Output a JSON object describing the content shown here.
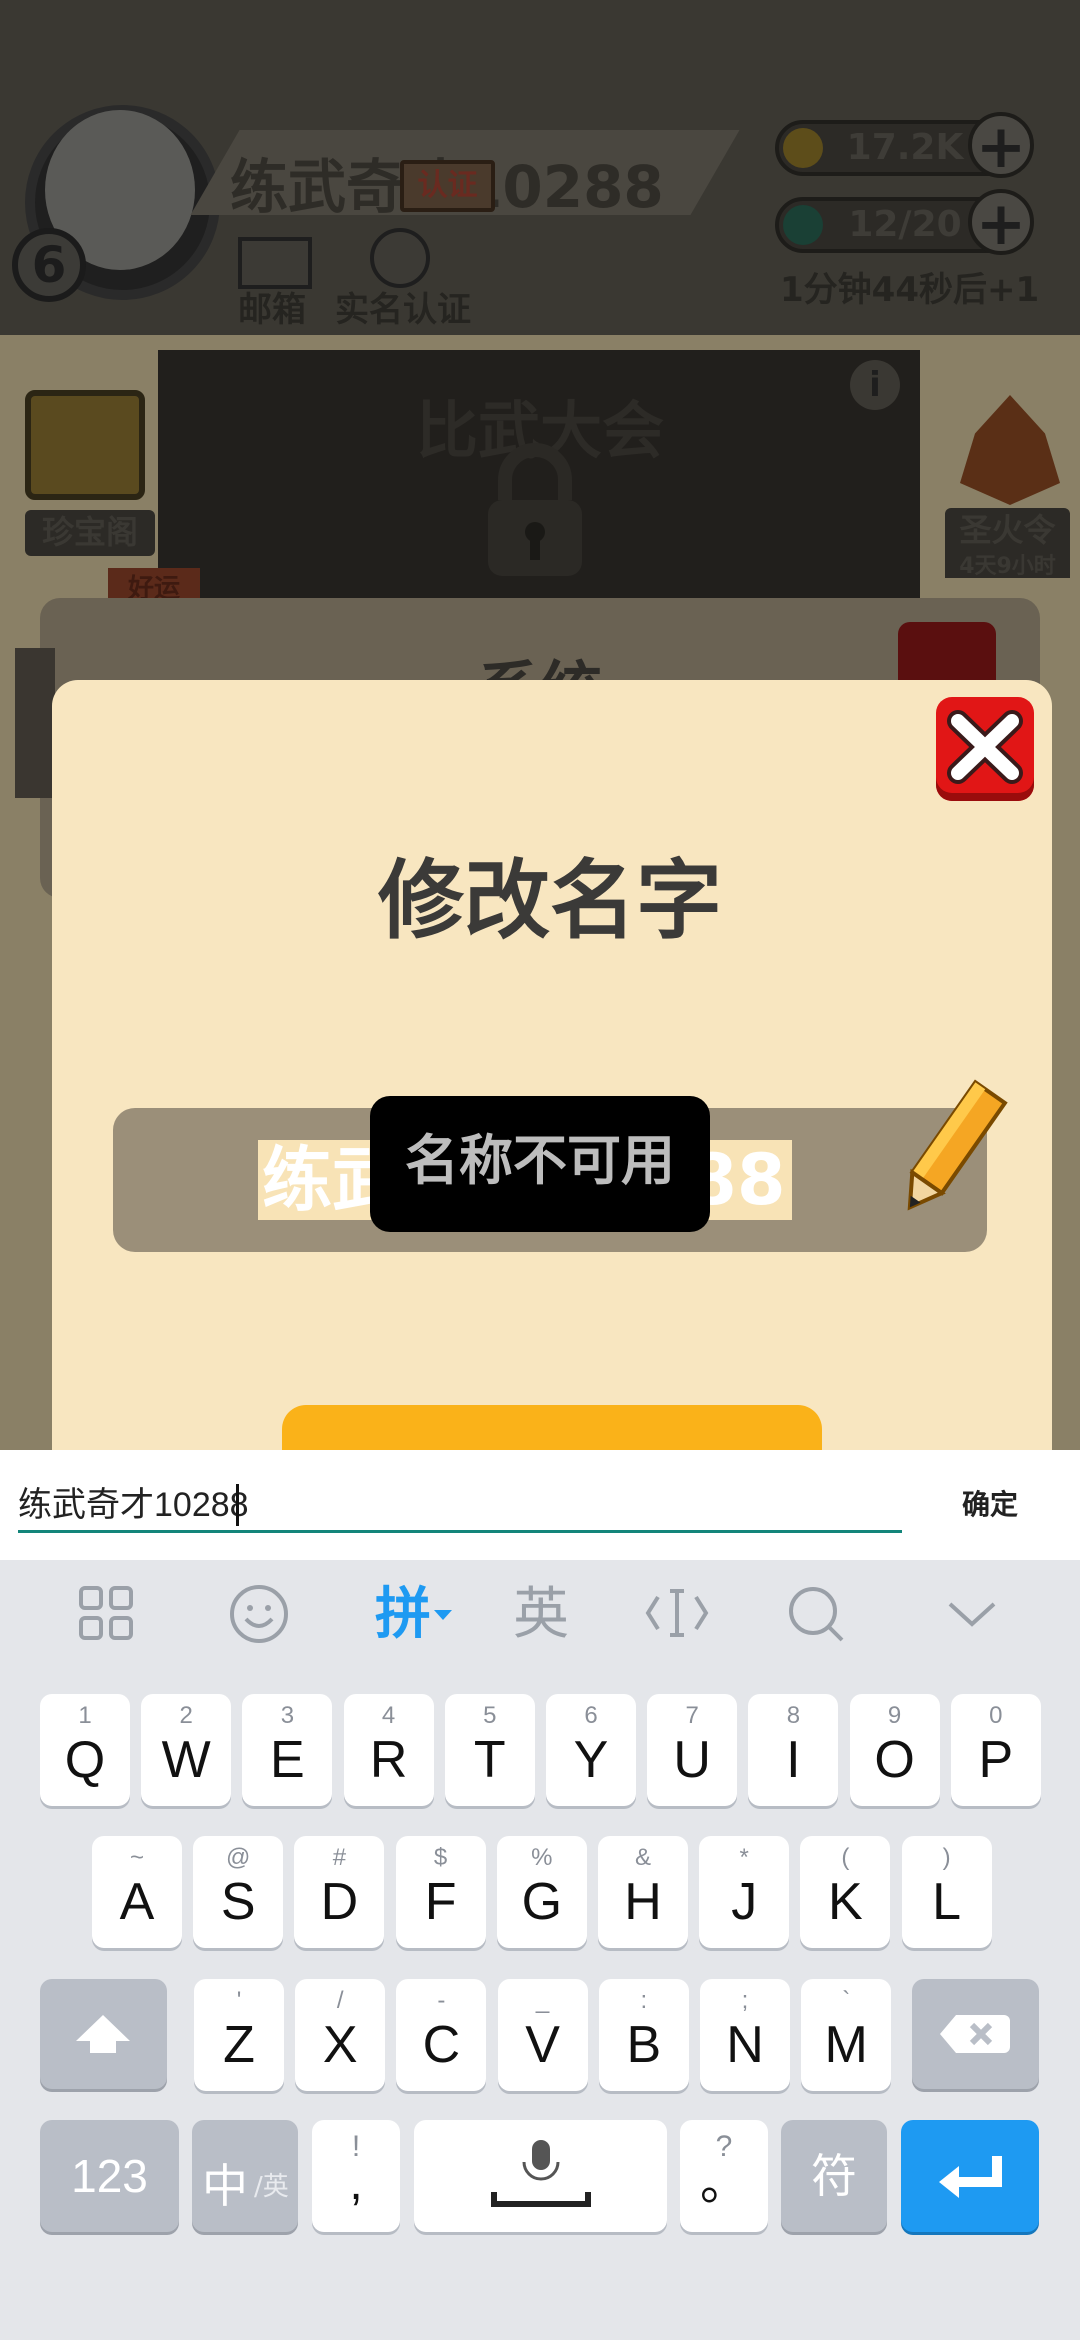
{
  "game": {
    "level": "6",
    "player_name": "练武奇才10288",
    "verify_tag": "认证",
    "mail_label": "邮箱",
    "realname_label": "实名认证",
    "coins": "17.2K",
    "energy": "12/20",
    "energy_timer": "1分钟44秒后+1",
    "plus": "+",
    "arena_title": "比武大会",
    "info": "i",
    "treasure_label": "珍宝阁",
    "fire_label": "圣火令",
    "fire_timer": "4天9小时",
    "lucky_tag": "好运",
    "system_title": "系统"
  },
  "dialog": {
    "title": "修改名字",
    "name_value": "练武奇才10288",
    "toast": "名称不可用"
  },
  "input_bar": {
    "text": "练武奇才10288",
    "confirm": "确定"
  },
  "keyboard": {
    "toolbar": {
      "pinyin": "拼",
      "english": "英"
    },
    "rows": [
      [
        {
          "main": "Q",
          "sub": "1"
        },
        {
          "main": "W",
          "sub": "2"
        },
        {
          "main": "E",
          "sub": "3"
        },
        {
          "main": "R",
          "sub": "4"
        },
        {
          "main": "T",
          "sub": "5"
        },
        {
          "main": "Y",
          "sub": "6"
        },
        {
          "main": "U",
          "sub": "7"
        },
        {
          "main": "I",
          "sub": "8"
        },
        {
          "main": "O",
          "sub": "9"
        },
        {
          "main": "P",
          "sub": "0"
        }
      ],
      [
        {
          "main": "A",
          "sub": "~"
        },
        {
          "main": "S",
          "sub": "@"
        },
        {
          "main": "D",
          "sub": "#"
        },
        {
          "main": "F",
          "sub": "$"
        },
        {
          "main": "G",
          "sub": "%"
        },
        {
          "main": "H",
          "sub": "&"
        },
        {
          "main": "J",
          "sub": "*"
        },
        {
          "main": "K",
          "sub": "("
        },
        {
          "main": "L",
          "sub": ")"
        }
      ],
      [
        {
          "main": "Z",
          "sub": "'"
        },
        {
          "main": "X",
          "sub": "/"
        },
        {
          "main": "C",
          "sub": "-"
        },
        {
          "main": "V",
          "sub": "_"
        },
        {
          "main": "B",
          "sub": ":"
        },
        {
          "main": "N",
          "sub": ";"
        },
        {
          "main": "M",
          "sub": "`"
        }
      ]
    ],
    "num_key": "123",
    "lang_key_main": "中",
    "lang_key_sub": "/英",
    "comma_main": ",",
    "comma_sub": "!",
    "period_main": "。",
    "period_sub": "?",
    "symbol_key": "符"
  }
}
